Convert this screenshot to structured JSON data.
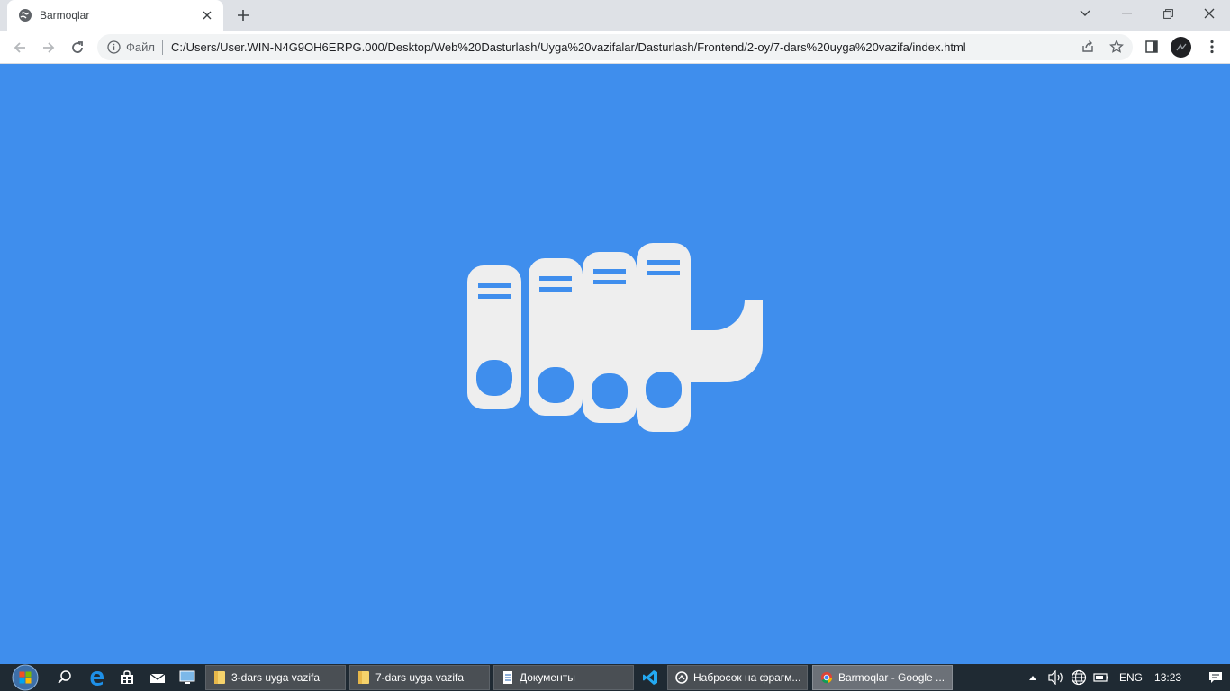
{
  "browser": {
    "tab_title": "Barmoqlar",
    "address_scheme": "Файл",
    "address_url": "C:/Users/User.WIN-N4G9OH6ERPG.000/Desktop/Web%20Dasturlash/Uyga%20vazifalar/Dasturlash/Frontend/2-oy/7-dars%20uyga%20vazifa/index.html"
  },
  "page": {
    "background_color": "#3f8eed",
    "finger_color": "#eeeeee",
    "accent_color": "#3f8eed"
  },
  "taskbar": {
    "buttons": [
      {
        "label": "3-dars uyga vazifa",
        "icon": "folder-icon"
      },
      {
        "label": "7-dars uyga vazifa",
        "icon": "folder-icon"
      },
      {
        "label": "Документы",
        "icon": "document-icon"
      },
      {
        "label": "Набросок на фрагм...",
        "icon": "snip-icon"
      },
      {
        "label": "Barmoqlar - Google ...",
        "icon": "chrome-icon"
      }
    ],
    "language": "ENG",
    "time": "13:23"
  }
}
